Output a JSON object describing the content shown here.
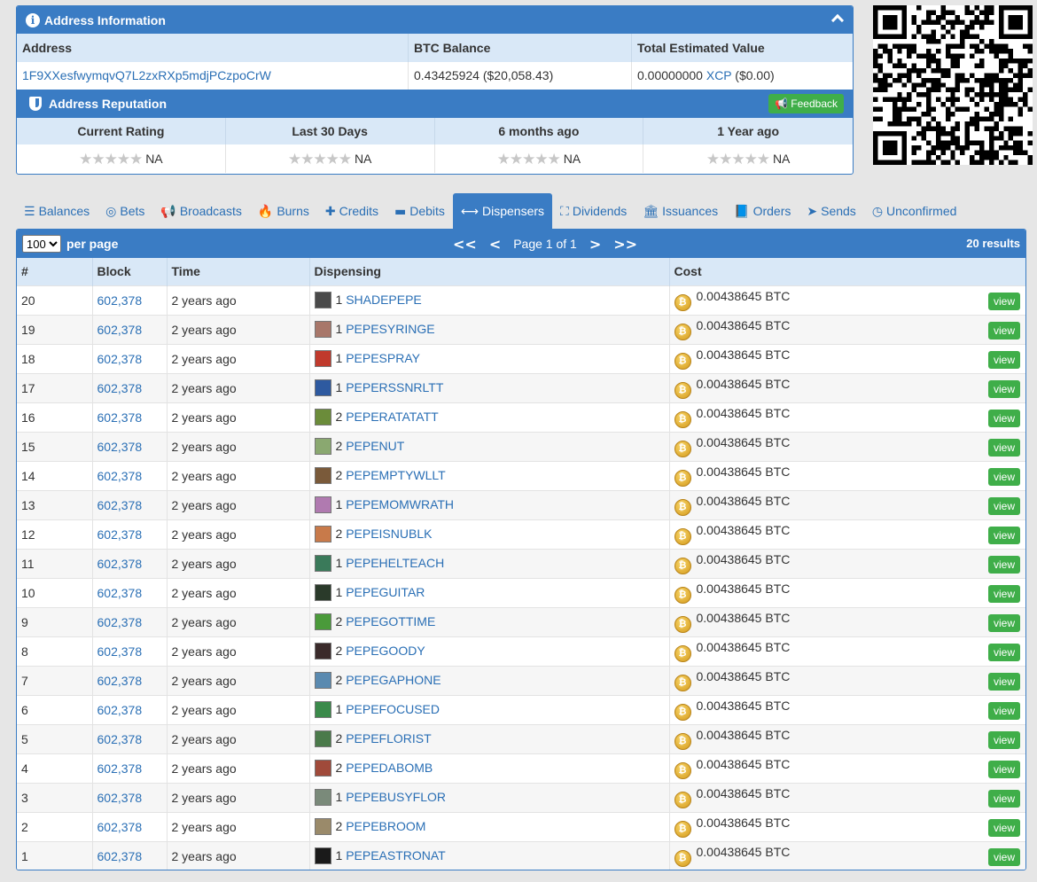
{
  "address_panel": {
    "title": "Address Information",
    "columns": [
      "Address",
      "BTC Balance",
      "Total Estimated Value"
    ],
    "address": "1F9XXesfwymqvQ7L2zxRXp5mdjPCzpoCrW",
    "btc_balance": "0.43425924 ($20,058.43)",
    "est_value_amount": "0.00000000",
    "est_value_asset": "XCP",
    "est_value_usd": "($0.00)"
  },
  "reputation": {
    "title": "Address Reputation",
    "feedback_label": "Feedback",
    "columns": [
      "Current Rating",
      "Last 30 Days",
      "6 months ago",
      "1 Year ago"
    ],
    "stars": "★★★★★",
    "values": [
      "NA",
      "NA",
      "NA",
      "NA"
    ]
  },
  "tabs": [
    {
      "label": "Balances",
      "icon": "list-icon",
      "glyph": "☰"
    },
    {
      "label": "Bets",
      "icon": "target-icon",
      "glyph": "◎"
    },
    {
      "label": "Broadcasts",
      "icon": "megaphone-icon",
      "glyph": "📢"
    },
    {
      "label": "Burns",
      "icon": "fire-icon",
      "glyph": "🔥"
    },
    {
      "label": "Credits",
      "icon": "plus-icon",
      "glyph": "✚"
    },
    {
      "label": "Debits",
      "icon": "minus-icon",
      "glyph": "▬"
    },
    {
      "label": "Dispensers",
      "icon": "arrows-h-icon",
      "glyph": "⟷",
      "active": true
    },
    {
      "label": "Dividends",
      "icon": "sitemap-icon",
      "glyph": "⛶"
    },
    {
      "label": "Issuances",
      "icon": "bank-icon",
      "glyph": "🏛"
    },
    {
      "label": "Orders",
      "icon": "book-icon",
      "glyph": "📘"
    },
    {
      "label": "Sends",
      "icon": "send-icon",
      "glyph": "➤"
    },
    {
      "label": "Unconfirmed",
      "icon": "clock-icon",
      "glyph": "◷"
    }
  ],
  "pager": {
    "per_page_value": "100",
    "per_page_label": "per page",
    "first": "<<",
    "prev": "<",
    "page_text": "Page 1 of 1",
    "next": ">",
    "last": ">>",
    "results": "20 results"
  },
  "table": {
    "columns": [
      "#",
      "Block",
      "Time",
      "Dispensing",
      "Cost"
    ],
    "view_label": "view",
    "rows": [
      {
        "n": "20",
        "block": "602,378",
        "time": "2 years ago",
        "qty": "1",
        "asset": "SHADEPEPE",
        "cost": "0.00438645 BTC",
        "thumb": "#4a4a4a"
      },
      {
        "n": "19",
        "block": "602,378",
        "time": "2 years ago",
        "qty": "1",
        "asset": "PEPESYRINGE",
        "cost": "0.00438645 BTC",
        "thumb": "#a8776a"
      },
      {
        "n": "18",
        "block": "602,378",
        "time": "2 years ago",
        "qty": "1",
        "asset": "PEPESPRAY",
        "cost": "0.00438645 BTC",
        "thumb": "#c03a2c"
      },
      {
        "n": "17",
        "block": "602,378",
        "time": "2 years ago",
        "qty": "1",
        "asset": "PEPERSSNRLTT",
        "cost": "0.00438645 BTC",
        "thumb": "#2e5aa0"
      },
      {
        "n": "16",
        "block": "602,378",
        "time": "2 years ago",
        "qty": "2",
        "asset": "PEPERATATATT",
        "cost": "0.00438645 BTC",
        "thumb": "#6b8c3a"
      },
      {
        "n": "15",
        "block": "602,378",
        "time": "2 years ago",
        "qty": "2",
        "asset": "PEPENUT",
        "cost": "0.00438645 BTC",
        "thumb": "#8aa870"
      },
      {
        "n": "14",
        "block": "602,378",
        "time": "2 years ago",
        "qty": "2",
        "asset": "PEPEMPTYWLLT",
        "cost": "0.00438645 BTC",
        "thumb": "#7a5a3a"
      },
      {
        "n": "13",
        "block": "602,378",
        "time": "2 years ago",
        "qty": "1",
        "asset": "PEPEMOMWRATH",
        "cost": "0.00438645 BTC",
        "thumb": "#b07ab0"
      },
      {
        "n": "12",
        "block": "602,378",
        "time": "2 years ago",
        "qty": "2",
        "asset": "PEPEISNUBLK",
        "cost": "0.00438645 BTC",
        "thumb": "#c87a4a"
      },
      {
        "n": "11",
        "block": "602,378",
        "time": "2 years ago",
        "qty": "1",
        "asset": "PEPEHELTEACH",
        "cost": "0.00438645 BTC",
        "thumb": "#3a7a5a"
      },
      {
        "n": "10",
        "block": "602,378",
        "time": "2 years ago",
        "qty": "1",
        "asset": "PEPEGUITAR",
        "cost": "0.00438645 BTC",
        "thumb": "#2a3a2a"
      },
      {
        "n": "9",
        "block": "602,378",
        "time": "2 years ago",
        "qty": "2",
        "asset": "PEPEGOTTIME",
        "cost": "0.00438645 BTC",
        "thumb": "#4a9a3a"
      },
      {
        "n": "8",
        "block": "602,378",
        "time": "2 years ago",
        "qty": "2",
        "asset": "PEPEGOODY",
        "cost": "0.00438645 BTC",
        "thumb": "#3a2a2a"
      },
      {
        "n": "7",
        "block": "602,378",
        "time": "2 years ago",
        "qty": "2",
        "asset": "PEPEGAPHONE",
        "cost": "0.00438645 BTC",
        "thumb": "#5a8ab0"
      },
      {
        "n": "6",
        "block": "602,378",
        "time": "2 years ago",
        "qty": "1",
        "asset": "PEPEFOCUSED",
        "cost": "0.00438645 BTC",
        "thumb": "#3a8a4a"
      },
      {
        "n": "5",
        "block": "602,378",
        "time": "2 years ago",
        "qty": "2",
        "asset": "PEPEFLORIST",
        "cost": "0.00438645 BTC",
        "thumb": "#4a7a4a"
      },
      {
        "n": "4",
        "block": "602,378",
        "time": "2 years ago",
        "qty": "2",
        "asset": "PEPEDABOMB",
        "cost": "0.00438645 BTC",
        "thumb": "#a04a3a"
      },
      {
        "n": "3",
        "block": "602,378",
        "time": "2 years ago",
        "qty": "1",
        "asset": "PEPEBUSYFLOR",
        "cost": "0.00438645 BTC",
        "thumb": "#7a8a7a"
      },
      {
        "n": "2",
        "block": "602,378",
        "time": "2 years ago",
        "qty": "2",
        "asset": "PEPEBROOM",
        "cost": "0.00438645 BTC",
        "thumb": "#9a8a6a"
      },
      {
        "n": "1",
        "block": "602,378",
        "time": "2 years ago",
        "qty": "1",
        "asset": "PEPEASTRONAT",
        "cost": "0.00438645 BTC",
        "thumb": "#1a1a1a"
      }
    ]
  },
  "colors": {
    "panel_blue": "#3a7cc4",
    "header_row": "#d9e8f7",
    "link": "#2a6fb5",
    "green_button": "#3fae49",
    "coin_gold": "#e0ac2c"
  }
}
